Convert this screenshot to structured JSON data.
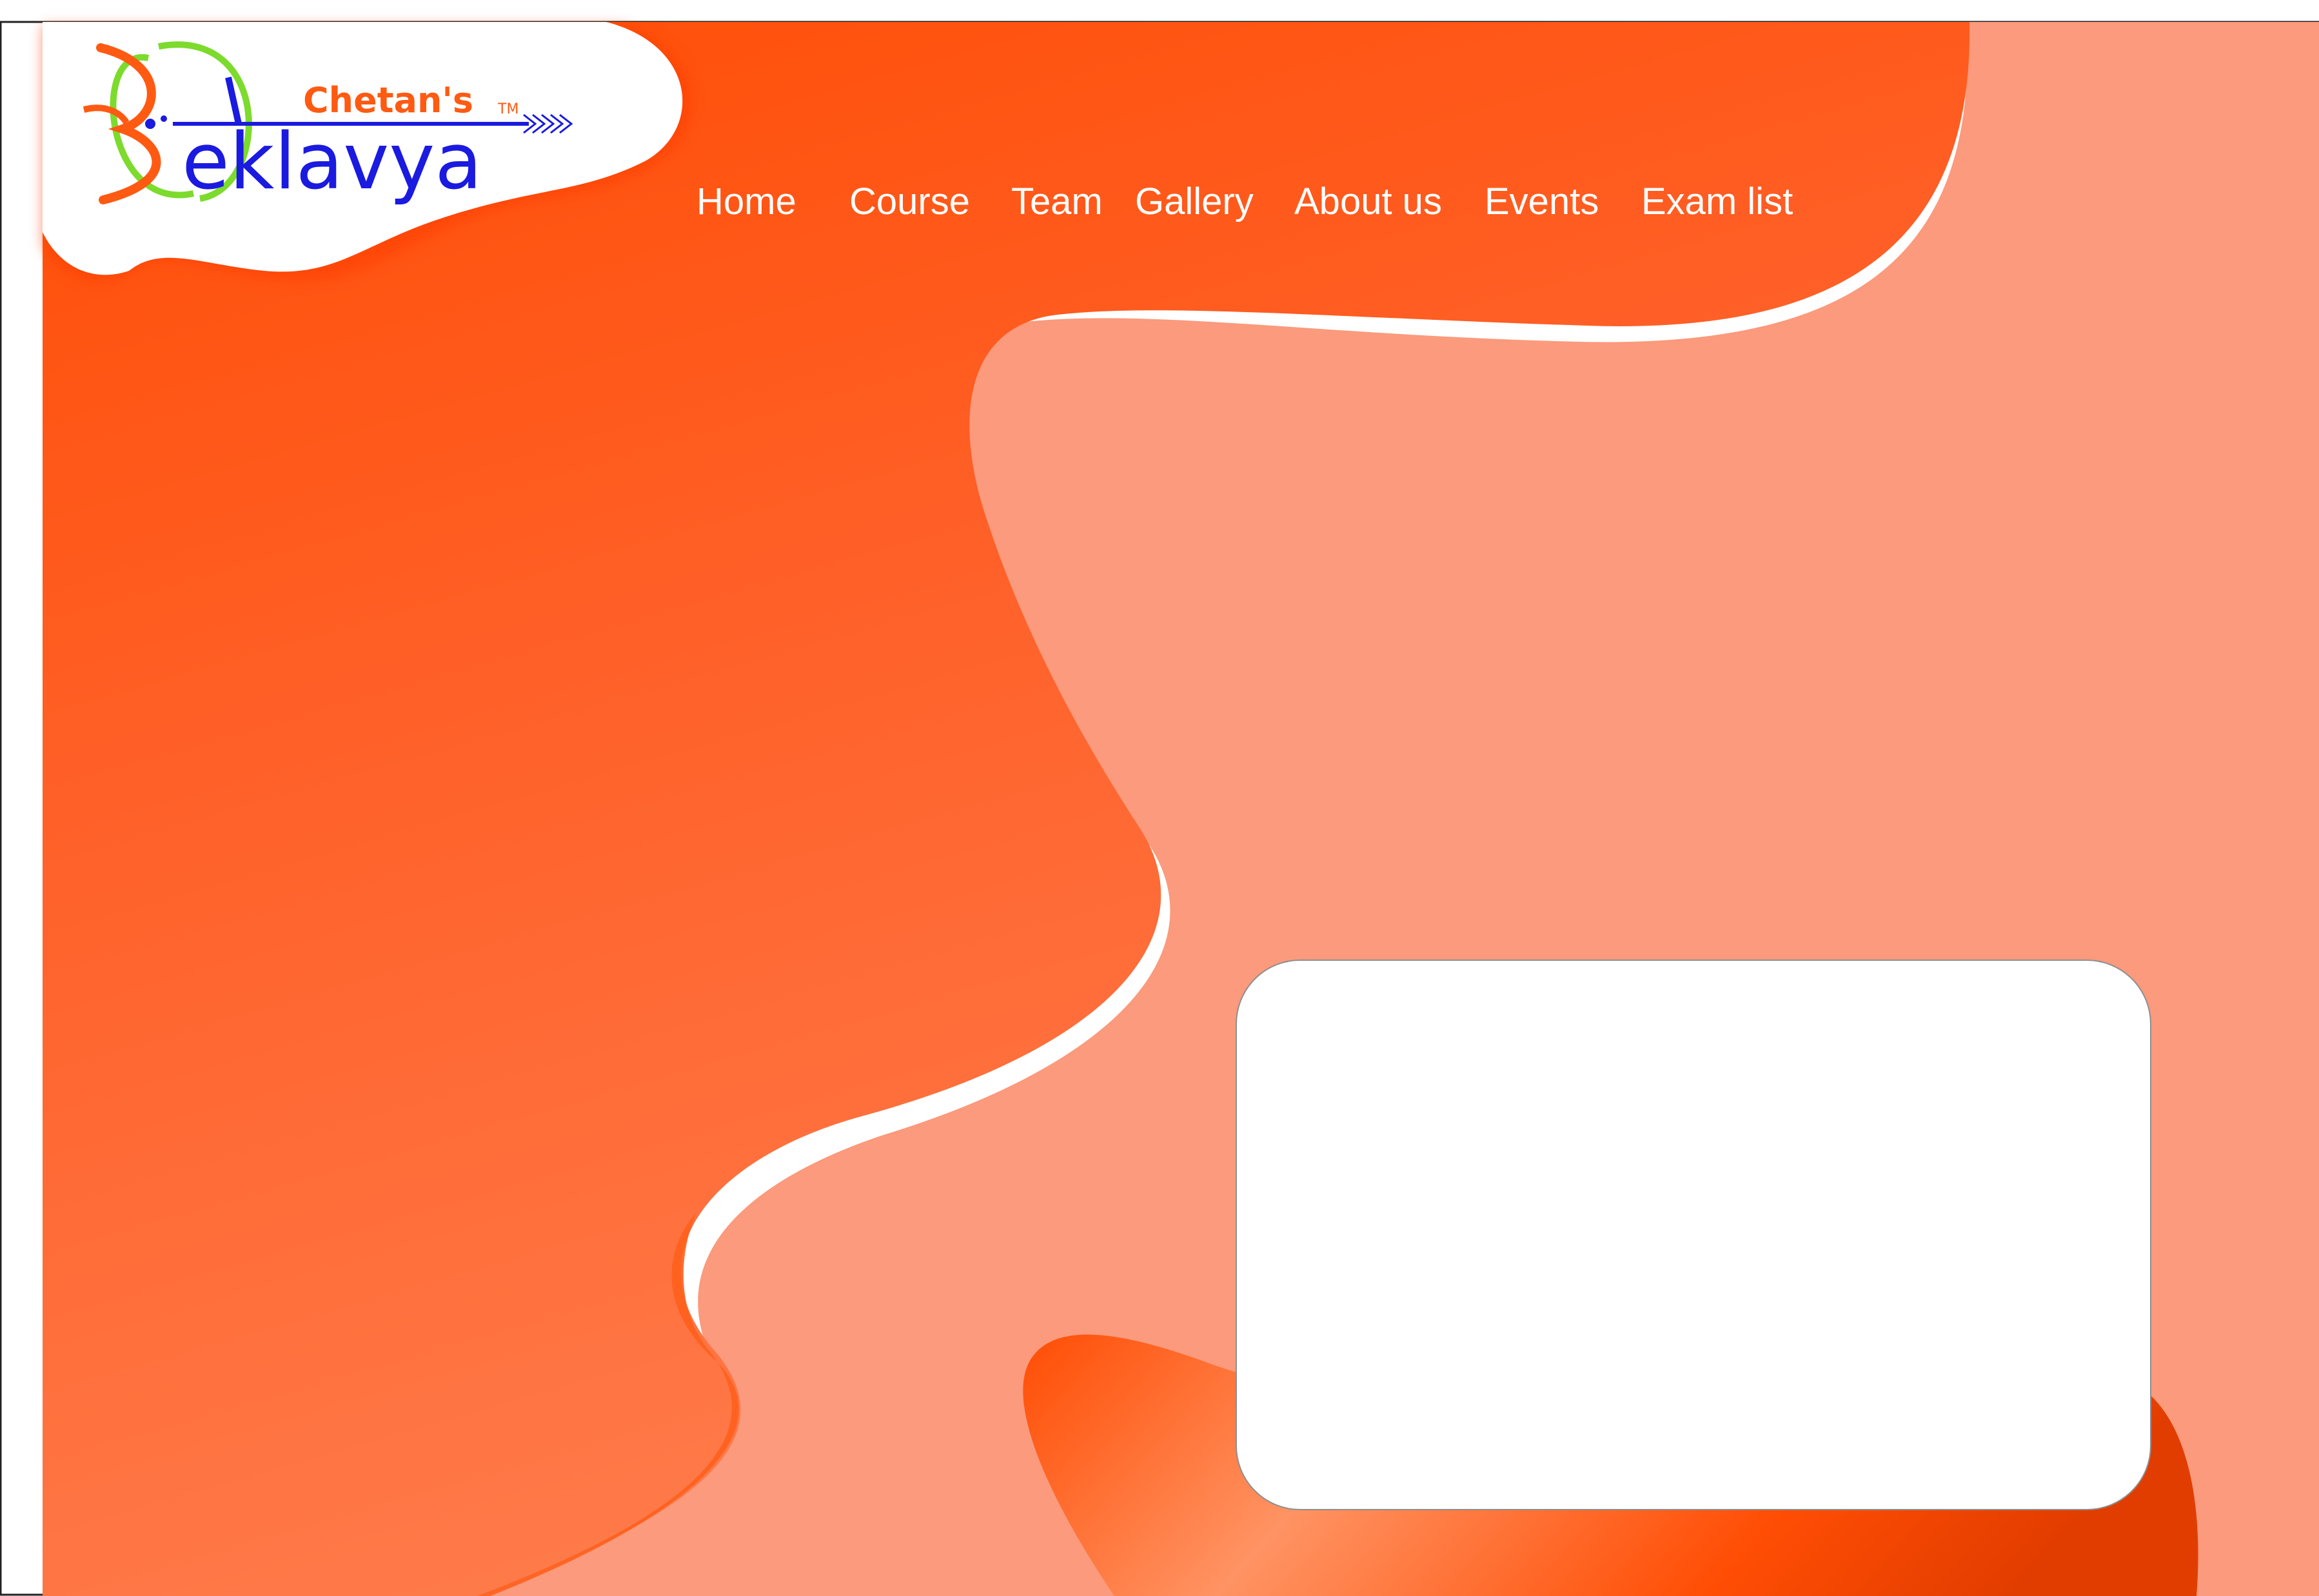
{
  "brand": {
    "prefix": "Chetan's",
    "name": "eklavya",
    "trademark": "TM",
    "colors": {
      "prefix": "#ff5a12",
      "name": "#1a1ae0",
      "ring": "#7cdb2c"
    }
  },
  "nav": {
    "items": [
      {
        "label": "Home"
      },
      {
        "label": "Course"
      },
      {
        "label": "Team"
      },
      {
        "label": "Gallery"
      },
      {
        "label": "About us"
      },
      {
        "label": "Events"
      },
      {
        "label": "Exam list"
      }
    ]
  },
  "theme": {
    "accent": "#ff4d04",
    "accent_light": "#ff7a4a",
    "shadow_tint": "#fb9a7c",
    "background": "#ffffff",
    "card_border": "#8f8f8f"
  },
  "content_card": {
    "text": ""
  }
}
